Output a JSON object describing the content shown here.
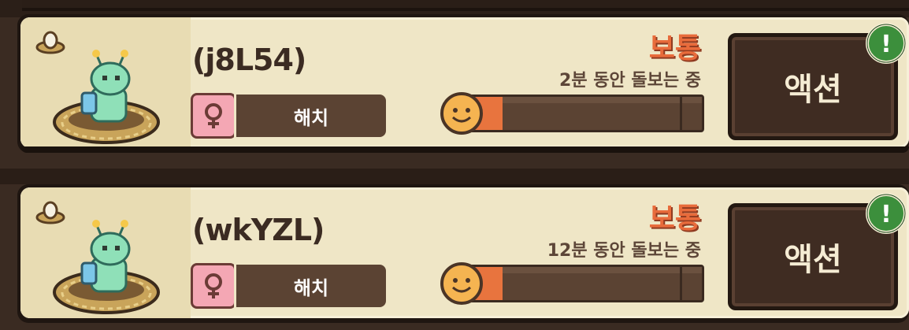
{
  "colors": {
    "card_background": "#efe6c6",
    "mood_text": "#e86b3b",
    "button_background": "#3f2c22",
    "alert_green": "#3c8f3c"
  },
  "pets": [
    {
      "name": "(j8L54)",
      "stage_label": "해치",
      "gender": "female",
      "mood": "보통",
      "care_status": "2분 동안 돌보는 중",
      "progress": 0.18,
      "action_label": "액션",
      "alert_icon": "!"
    },
    {
      "name": "(wkYZL)",
      "stage_label": "해치",
      "gender": "female",
      "mood": "보통",
      "care_status": "12분 동안 돌보는 중",
      "progress": 0.18,
      "action_label": "액션",
      "alert_icon": "!"
    }
  ]
}
